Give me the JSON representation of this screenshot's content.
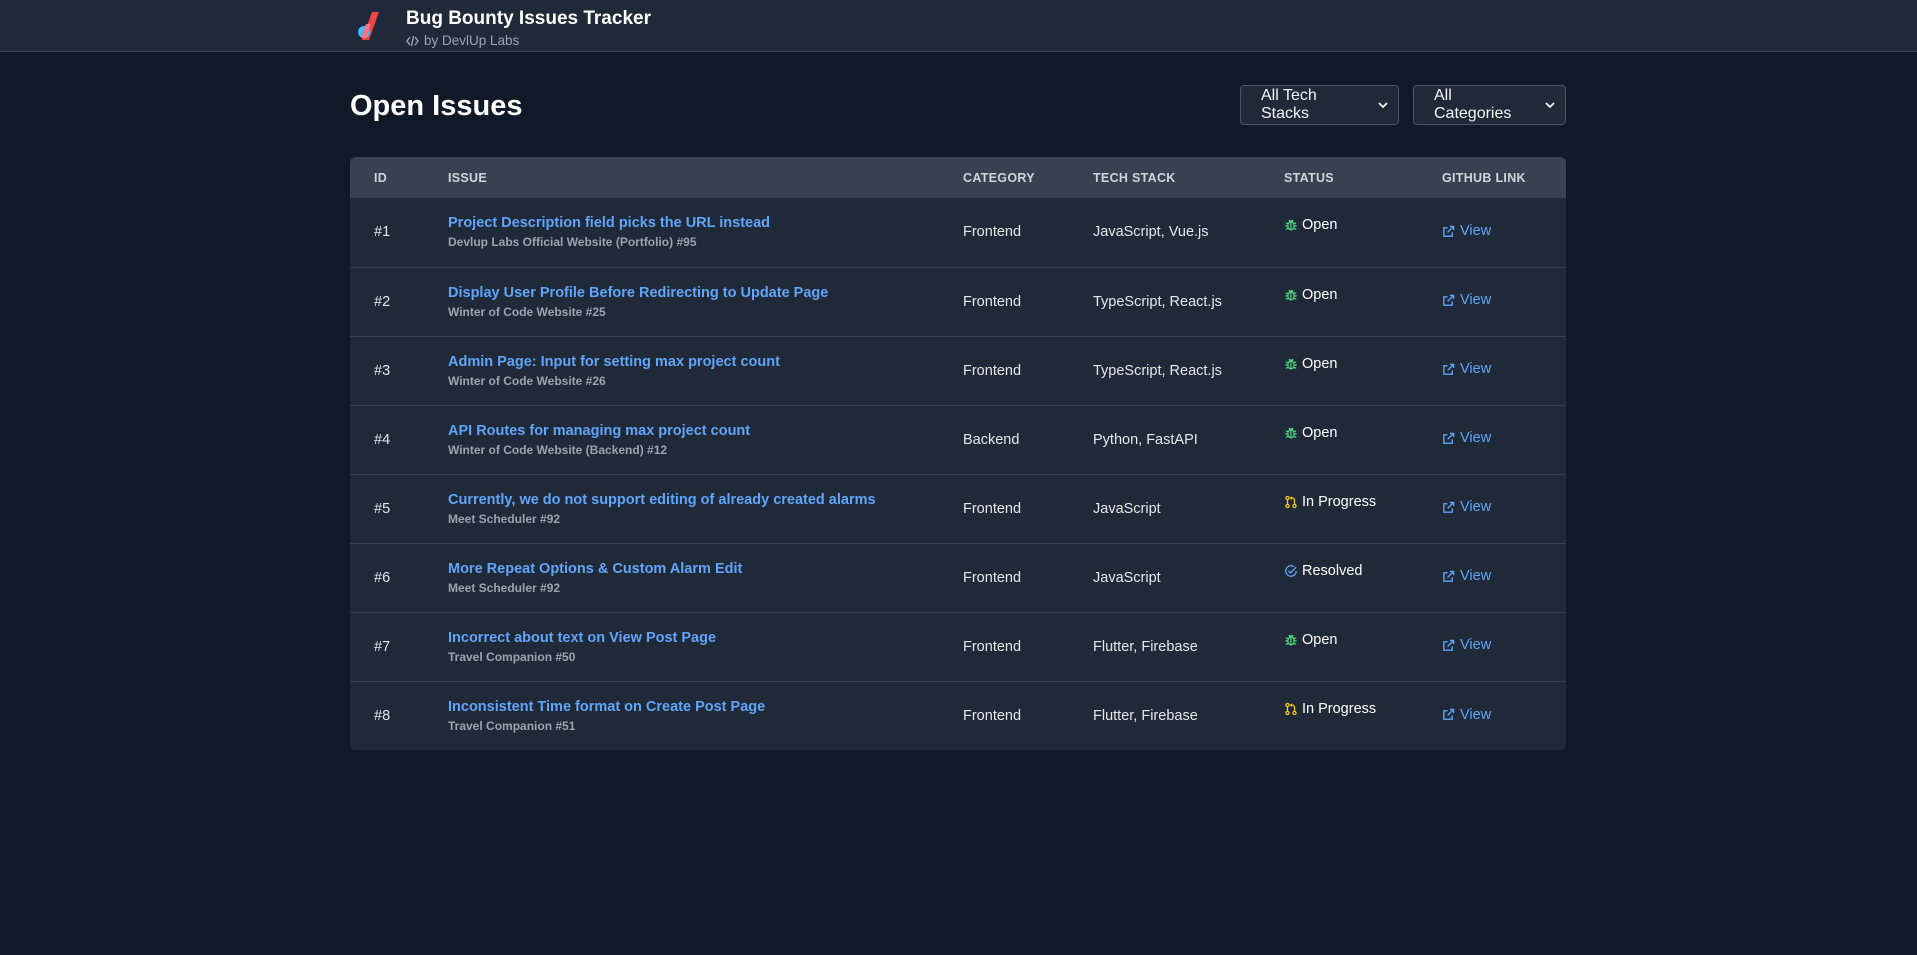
{
  "header": {
    "title": "Bug Bounty Issues Tracker",
    "subtitle": "by DevlUp Labs",
    "logo_icon": "devlup-logo-icon"
  },
  "main": {
    "heading": "Open Issues",
    "filters": {
      "tech_stack": "All Tech Stacks",
      "category": "All Categories"
    }
  },
  "table": {
    "columns": {
      "id": "ID",
      "issue": "ISSUE",
      "category": "CATEGORY",
      "tech_stack": "TECH STACK",
      "status": "STATUS",
      "github_link": "GITHUB LINK"
    },
    "rows": [
      {
        "id": "#1",
        "title": "Project Description field picks the URL instead",
        "repo": "Devlup Labs Official Website (Portfolio) #95",
        "category": "Frontend",
        "tech": "JavaScript, Vue.js",
        "status": "Open",
        "status_kind": "open",
        "link": "View"
      },
      {
        "id": "#2",
        "title": "Display User Profile Before Redirecting to Update Page",
        "repo": "Winter of Code Website #25",
        "category": "Frontend",
        "tech": "TypeScript, React.js",
        "status": "Open",
        "status_kind": "open",
        "link": "View"
      },
      {
        "id": "#3",
        "title": "Admin Page: Input for setting max project count",
        "repo": "Winter of Code Website #26",
        "category": "Frontend",
        "tech": "TypeScript, React.js",
        "status": "Open",
        "status_kind": "open",
        "link": "View"
      },
      {
        "id": "#4",
        "title": "API Routes for managing max project count",
        "repo": "Winter of Code Website (Backend) #12",
        "category": "Backend",
        "tech": "Python, FastAPI",
        "status": "Open",
        "status_kind": "open",
        "link": "View"
      },
      {
        "id": "#5",
        "title": "Currently, we do not support editing of already created alarms",
        "repo": "Meet Scheduler #92",
        "category": "Frontend",
        "tech": "JavaScript",
        "status": "In Progress",
        "status_kind": "progress",
        "link": "View"
      },
      {
        "id": "#6",
        "title": "More Repeat Options & Custom Alarm Edit",
        "repo": "Meet Scheduler #92",
        "category": "Frontend",
        "tech": "JavaScript",
        "status": "Resolved",
        "status_kind": "resolved",
        "link": "View"
      },
      {
        "id": "#7",
        "title": "Incorrect about text on View Post Page",
        "repo": "Travel Companion #50",
        "category": "Frontend",
        "tech": "Flutter, Firebase",
        "status": "Open",
        "status_kind": "open",
        "link": "View"
      },
      {
        "id": "#8",
        "title": "Inconsistent Time format on Create Post Page",
        "repo": "Travel Companion #51",
        "category": "Frontend",
        "tech": "Flutter, Firebase",
        "status": "In Progress",
        "status_kind": "progress",
        "link": "View"
      }
    ]
  },
  "colors": {
    "background": "#111827",
    "surface": "#1f2937",
    "header_row": "#374151",
    "link": "#60a5fa",
    "open": "#4ade80",
    "progress": "#facc15",
    "resolved": "#60a5fa"
  },
  "icons": {
    "open": "bug-icon",
    "progress": "git-pull-request-icon",
    "resolved": "check-circle-icon",
    "link": "external-link-icon"
  }
}
